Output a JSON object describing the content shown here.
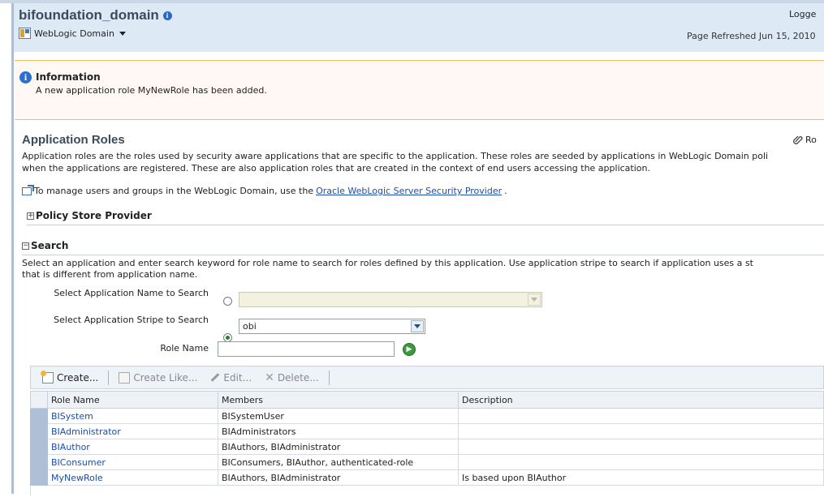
{
  "header": {
    "title": "bifoundation_domain",
    "logged_text": "Logge",
    "domain_menu_label": "WebLogic Domain",
    "refreshed_text": "Page Refreshed Jun 15, 2010"
  },
  "info": {
    "title": "Information",
    "message": "A new application role MyNewRole has been added."
  },
  "roles": {
    "title": "Application Roles",
    "corner_link": "Ro",
    "description_line1": "Application roles are the roles used by security aware applications that are specific to the application. These roles are seeded by applications in WebLogic Domain poli",
    "description_line2": "when the applications are registered. These are also application roles that are created in the context of end users accessing the application.",
    "manage_prefix": "To manage users and groups in the WebLogic Domain, use the ",
    "manage_link": "Oracle WebLogic Server Security Provider",
    "manage_suffix": "."
  },
  "policy_store": {
    "label": "Policy Store Provider"
  },
  "search": {
    "label": "Search",
    "desc_line1": "Select an application and enter search keyword for role name to search for roles defined by this application. Use application stripe to search if application uses a st",
    "desc_line2": "that is different from application name.",
    "app_name_label": "Select Application Name to Search",
    "app_name_value": "",
    "stripe_label": "Select Application Stripe to Search",
    "stripe_value": "obi",
    "role_name_label": "Role Name",
    "role_name_value": ""
  },
  "toolbar": {
    "create": "Create...",
    "create_like": "Create Like...",
    "edit": "Edit...",
    "delete": "Delete..."
  },
  "table": {
    "headers": [
      "Role Name",
      "Members",
      "Description"
    ],
    "rows": [
      {
        "role": "BISystem",
        "members": "BISystemUser",
        "description": ""
      },
      {
        "role": "BIAdministrator",
        "members": "BIAdministrators",
        "description": ""
      },
      {
        "role": "BIAuthor",
        "members": "BIAuthors, BIAdministrator",
        "description": ""
      },
      {
        "role": "BIConsumer",
        "members": "BIConsumers, BIAuthor, authenticated-role",
        "description": ""
      },
      {
        "role": "MyNewRole",
        "members": "BIAuthors, BIAdministrator",
        "description": "Is based upon BIAuthor"
      }
    ]
  },
  "colors": {
    "header_bg": "#ddeaf6",
    "title_color": "#3d4a5c",
    "link_color": "#1c4ea8",
    "info_border": "#f0c060",
    "selected_row_bar": "#aec0d6"
  },
  "icons": {
    "info": "info-circle-icon",
    "domain": "weblogic-domain-icon",
    "ro": "paperclip-icon",
    "external": "external-link-icon",
    "create": "create-icon",
    "create_like": "create-like-icon",
    "edit": "pencil-icon",
    "delete": "delete-x-icon",
    "go": "go-arrow-icon"
  }
}
